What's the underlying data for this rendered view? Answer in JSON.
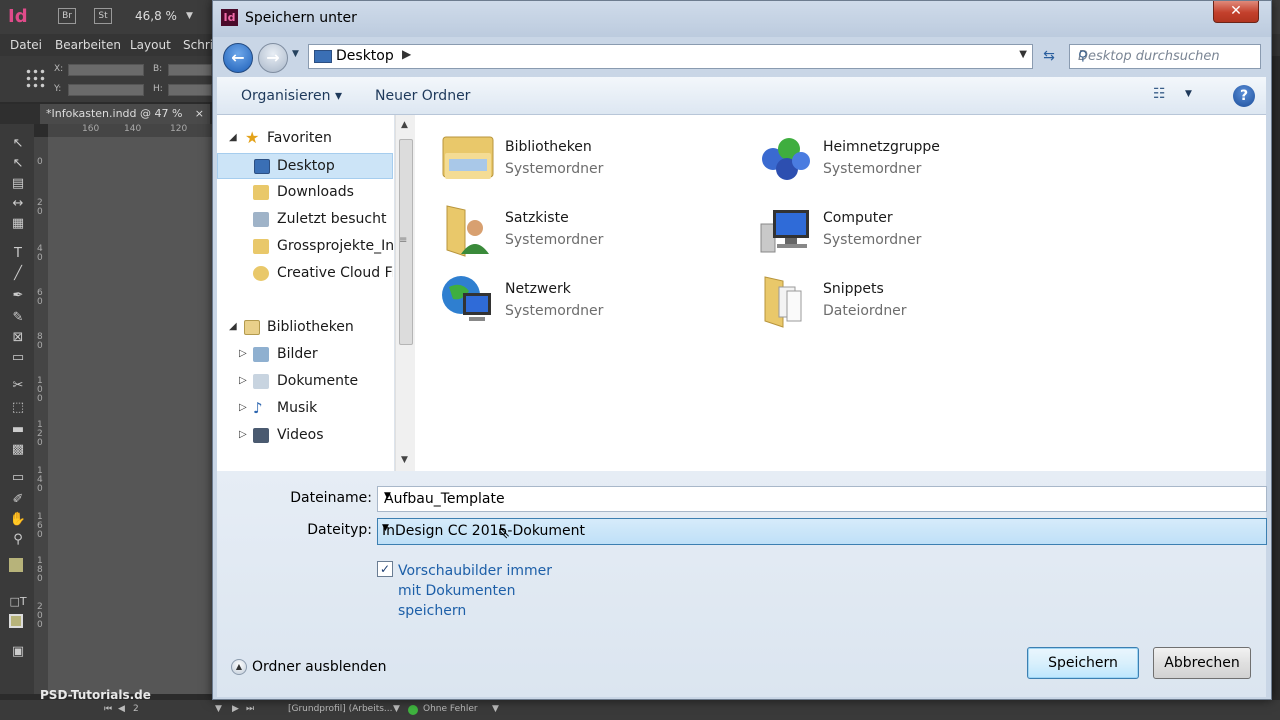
{
  "indesign": {
    "logo": "Id",
    "chip_br": "Br",
    "chip_st": "St",
    "zoom": "46,8 %",
    "menu": [
      "Datei",
      "Bearbeiten",
      "Layout",
      "Schri"
    ],
    "ctrl_x": "X:",
    "ctrl_y": "Y:",
    "ctrl_b": "B:",
    "ctrl_h": "H:",
    "doc_tab": "*Infokasten.indd @ 47 %",
    "ruler_h": [
      "160",
      "140",
      "120"
    ],
    "ruler_v": [
      "0",
      "2 0",
      "4 0",
      "6 0",
      "8 0",
      "1 0 0",
      "1 2 0",
      "1 4 0",
      "1 6 0",
      "1 8 0",
      "2 0 0"
    ],
    "status_page": "2",
    "status_profile": "[Grundprofil] (Arbeits...",
    "status_errors": "Ohne Fehler",
    "watermark": "PSD-Tutorials.de"
  },
  "dialog": {
    "title": "Speichern unter",
    "title_icon": "Id",
    "close": "✕",
    "address": "Desktop",
    "search_placeholder": "Desktop durchsuchen",
    "toolbar": {
      "organize": "Organisieren ▾",
      "new_folder": "Neuer Ordner",
      "help": "?"
    },
    "tree": [
      {
        "label": "Favoriten",
        "icon": "star-icon",
        "expander": "◢",
        "level": 0
      },
      {
        "label": "Desktop",
        "icon": "desktop-icon",
        "expander": "",
        "level": 1,
        "selected": true
      },
      {
        "label": "Downloads",
        "icon": "downloads-folder-icon",
        "expander": "",
        "level": 1
      },
      {
        "label": "Zuletzt besucht",
        "icon": "recent-places-icon",
        "expander": "",
        "level": 1
      },
      {
        "label": "Grossprojekte_InD",
        "icon": "folder-icon",
        "expander": "",
        "level": 1
      },
      {
        "label": "Creative Cloud Fil",
        "icon": "creative-cloud-icon",
        "expander": "",
        "level": 1
      },
      {
        "label": "",
        "icon": "",
        "expander": "",
        "level": 1
      },
      {
        "label": "Bibliotheken",
        "icon": "libraries-icon",
        "expander": "◢",
        "level": 0
      },
      {
        "label": "Bilder",
        "icon": "pictures-icon",
        "expander": "▷",
        "level": 1
      },
      {
        "label": "Dokumente",
        "icon": "documents-icon",
        "expander": "▷",
        "level": 1
      },
      {
        "label": "Musik",
        "icon": "music-icon",
        "expander": "▷",
        "level": 1
      },
      {
        "label": "Videos",
        "icon": "videos-icon",
        "expander": "▷",
        "level": 1
      }
    ],
    "items": [
      {
        "name": "Bibliotheken",
        "type": "Systemordner",
        "icon": "libraries-icon"
      },
      {
        "name": "Heimnetzgruppe",
        "type": "Systemordner",
        "icon": "homegroup-icon"
      },
      {
        "name": "Satzkiste",
        "type": "Systemordner",
        "icon": "user-folder-icon"
      },
      {
        "name": "Computer",
        "type": "Systemordner",
        "icon": "computer-icon"
      },
      {
        "name": "Netzwerk",
        "type": "Systemordner",
        "icon": "network-icon"
      },
      {
        "name": "Snippets",
        "type": "Dateiordner",
        "icon": "folder-icon"
      }
    ],
    "filename_label": "Dateiname:",
    "filename_value": "Aufbau_Template",
    "filetype_label": "Dateityp:",
    "filetype_value": "InDesign CC 2015-Dokument",
    "preview_checkbox_label": "Vorschaubilder immer mit Dokumenten speichern",
    "preview_checked": true,
    "hide_folders": "Ordner ausblenden",
    "save_button": "Speichern",
    "cancel_button": "Abbrechen"
  }
}
